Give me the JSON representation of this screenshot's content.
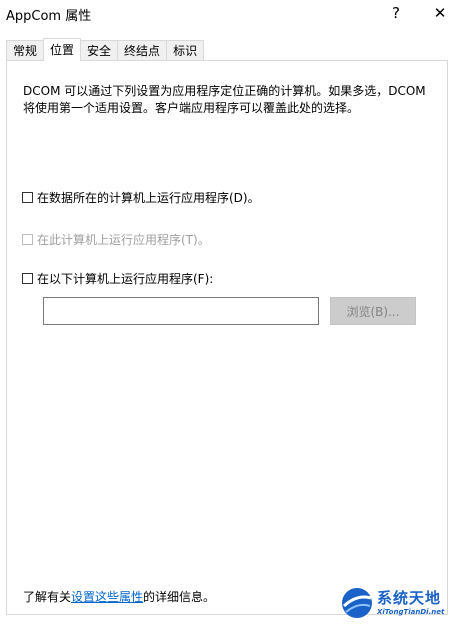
{
  "window": {
    "title": "AppCom 属性",
    "help_label": "?",
    "close_label": "✕"
  },
  "tabs": [
    {
      "label": "常规",
      "active": false
    },
    {
      "label": "位置",
      "active": true
    },
    {
      "label": "安全",
      "active": false
    },
    {
      "label": "终结点",
      "active": false
    },
    {
      "label": "标识",
      "active": false
    }
  ],
  "location": {
    "description": "DCOM 可以通过下列设置为应用程序定位正确的计算机。如果多选，DCOM 将使用第一个适用设置。客户端应用程序可以覆盖此处的选择。",
    "options": [
      {
        "label": "在数据所在的计算机上运行应用程序(D)。",
        "checked": false,
        "enabled": true
      },
      {
        "label": "在此计算机上运行应用程序(T)。",
        "checked": false,
        "enabled": false
      },
      {
        "label": "在以下计算机上运行应用程序(F):",
        "checked": false,
        "enabled": true
      }
    ],
    "computer_value": "",
    "browse_label": "浏览(B)..."
  },
  "info": {
    "prefix": "了解有关",
    "link": "设置这些属性",
    "suffix": "的详细信息。"
  },
  "watermark": {
    "brand": "系统天地",
    "url": "XiTongTianDi.net",
    "colors": {
      "primary": "#1a62c8"
    }
  }
}
